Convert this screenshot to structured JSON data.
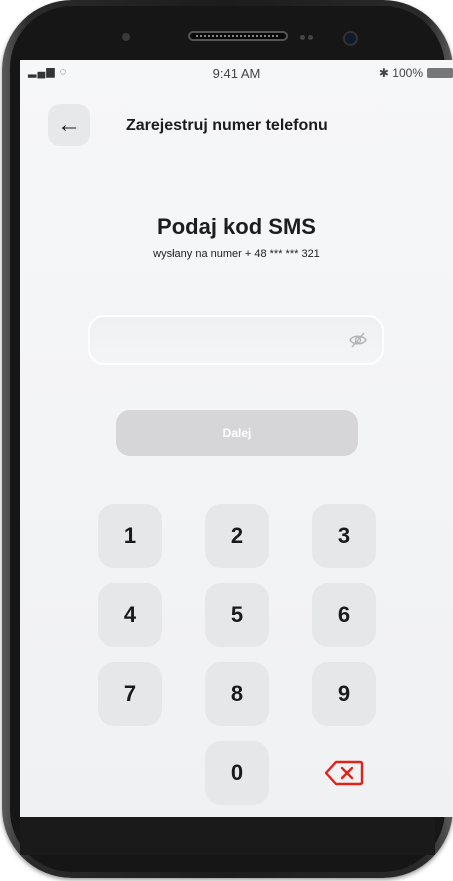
{
  "status_bar": {
    "signal": "▂▄▆ ◌",
    "time": "9:41 AM",
    "battery": "✱ 100%"
  },
  "header": {
    "back_icon": "←",
    "title": "Zarejestruj numer telefonu"
  },
  "main": {
    "title": "Podaj kod SMS",
    "subtitle": "wysłany na numer + 48 *** *** 321"
  },
  "code_input": {
    "value": "",
    "icon": "eye-off-icon"
  },
  "next_button": {
    "label": "Dalej"
  },
  "keypad": {
    "keys": [
      "1",
      "2",
      "3",
      "4",
      "5",
      "6",
      "7",
      "8",
      "9",
      "0"
    ],
    "delete_icon": "backspace-icon",
    "delete_color": "#e2231a"
  },
  "colors": {
    "background": "#f3f4f6",
    "disabled_button": "#d6d6d8",
    "key_bg": "#e6e7e9"
  }
}
